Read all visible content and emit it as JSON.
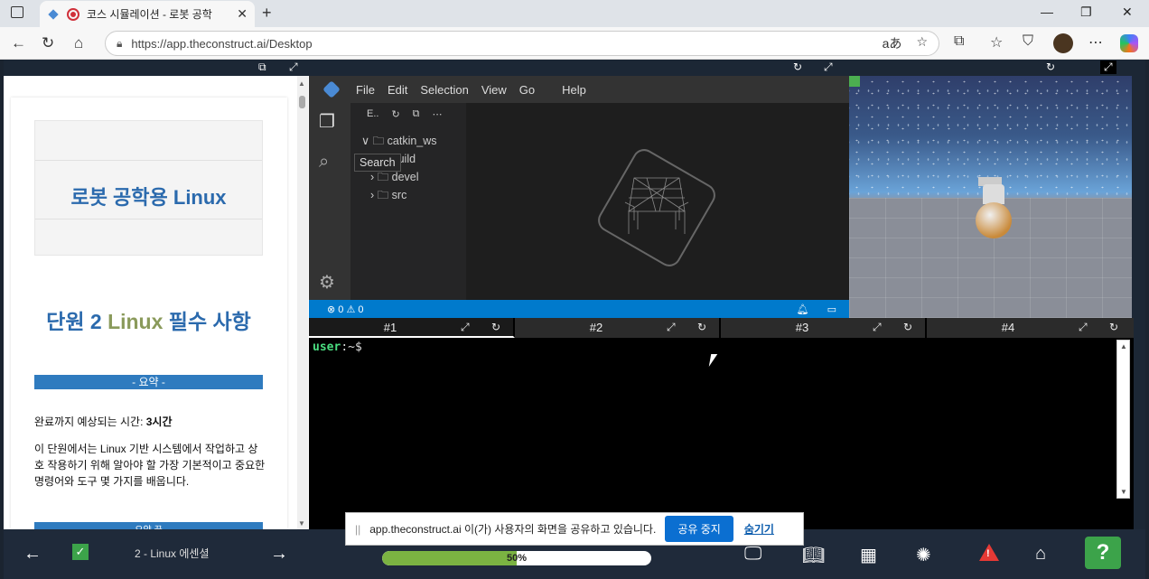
{
  "browser": {
    "tab_title": "코스 시뮬레이션 - 로봇 공학",
    "tab_close": "✕",
    "new_tab": "+",
    "url": "https://app.theconstruct.ai/Desktop",
    "translate_icon": "aあ",
    "window_controls": [
      "—",
      "❐",
      "✕"
    ]
  },
  "course": {
    "title": "로봇 공학용 Linux",
    "unit_prefix": "단원 2 ",
    "unit_green": "Linux",
    "unit_suffix": " 필수 사항",
    "summary_label": "- 요약 -",
    "time_label": "완료까지 예상되는 시간: ",
    "time_value": "3시간",
    "description": "이 단원에서는 Linux 기반 시스템에서 작업하고 상호 작용하기 위해 알아야 할 가장 기본적이고 중요한 명령어와 도구 몇 가지를 배웁니다.",
    "next_bar": "요약 끝"
  },
  "ide": {
    "menu": [
      "File",
      "Edit",
      "Selection",
      "View",
      "Go",
      "Help"
    ],
    "explorer_label": "E..",
    "tooltip": "Search",
    "tree": [
      {
        "label": "catkin_ws",
        "arrow": "∨"
      },
      {
        "label": "build",
        "arrow": "›"
      },
      {
        "label": "devel",
        "arrow": "›"
      },
      {
        "label": "src",
        "arrow": "›"
      }
    ],
    "status_errors": "⊗ 0 ⚠ 0"
  },
  "terminal": {
    "tabs": [
      "#1",
      "#2",
      "#3",
      "#4"
    ],
    "active_tab": "#1",
    "prompt_user": "user",
    "prompt_rest": ":~$"
  },
  "bottom": {
    "lesson": "2 - Linux 에센셜",
    "progress_label": "50%",
    "progress_value": 0.5,
    "help": "?"
  },
  "share_banner": {
    "text": "app.theconstruct.ai 이(가) 사용자의 화면을 공유하고 있습니다.",
    "stop_label": "공유 중지",
    "hide_label": "숨기기"
  },
  "colors": {
    "accent_blue": "#2b6aad",
    "unit_green": "#8a9a5b",
    "vscode_status": "#007acc",
    "progress_fill": "#7bb342",
    "help_green": "#3ca34a"
  }
}
